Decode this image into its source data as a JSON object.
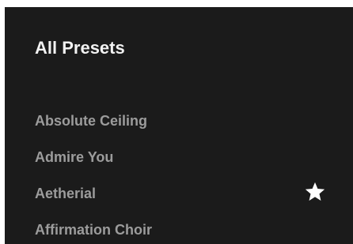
{
  "presets_panel": {
    "title": "All Presets",
    "items": [
      {
        "label": "Absolute Ceiling",
        "favorite": false
      },
      {
        "label": "Admire You",
        "favorite": false
      },
      {
        "label": "Aetherial",
        "favorite": true,
        "favorite_icon": "star-icon"
      },
      {
        "label": "Affirmation Choir",
        "favorite": false
      }
    ]
  },
  "colors": {
    "panel_background": "#1b1b1b",
    "title_text": "#f2f2f2",
    "item_text": "#9c9c9c",
    "star": "#ffffff"
  }
}
